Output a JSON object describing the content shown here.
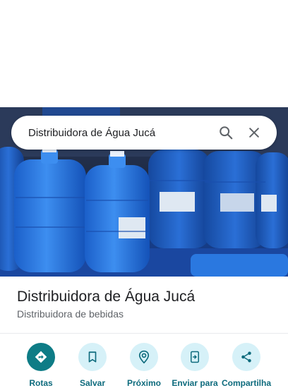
{
  "search": {
    "query": "Distribuidora de Água Jucá"
  },
  "place": {
    "name": "Distribuidora de Água Jucá",
    "category": "Distribuidora de bebidas"
  },
  "actions": [
    {
      "label": "Rotas",
      "icon": "directions-icon"
    },
    {
      "label": "Salvar",
      "icon": "bookmark-icon"
    },
    {
      "label": "Próximo",
      "icon": "nearby-icon"
    },
    {
      "label": "Enviar para",
      "icon": "send-to-device-icon"
    },
    {
      "label": "Compartilha",
      "icon": "share-icon"
    }
  ],
  "colors": {
    "primary": "#0e7c86",
    "tonal": "#d6f1f8",
    "label": "#0e6b7d"
  }
}
